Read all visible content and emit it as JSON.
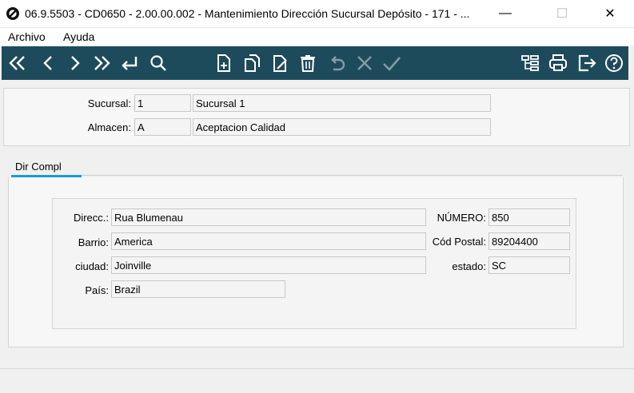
{
  "window": {
    "title": "06.9.5503 - CD0650 - 2.00.00.002 - Mantenimiento Dirección Sucursal Depósito - 171 - ...",
    "minimize": "—",
    "maximize": "☐",
    "close": "✕"
  },
  "menu": {
    "archivo": "Archivo",
    "ayuda": "Ayuda"
  },
  "toolbar": {
    "bg_color": "#1e4b5c",
    "left_icons": [
      "first-record-icon",
      "previous-record-icon",
      "next-record-icon",
      "last-record-icon",
      "goto-enter-icon",
      "search-icon"
    ],
    "mid_icons": [
      "new-record-icon",
      "copy-record-icon",
      "edit-record-icon",
      "delete-record-icon",
      "undo-icon",
      "cancel-icon",
      "confirm-icon"
    ],
    "right_icons": [
      "tree-icon",
      "print-icon",
      "exit-icon",
      "help-icon"
    ]
  },
  "header": {
    "sucursal_label": "Sucursal:",
    "sucursal_code": "1",
    "sucursal_name": "Sucursal 1",
    "almacen_label": "Almacen:",
    "almacen_code": "A",
    "almacen_name": "Aceptacion Calidad"
  },
  "tabs": {
    "dir_compl": "Dir Compl",
    "accent": "#1a9ad6"
  },
  "address": {
    "direcc_label": "Direcc.:",
    "direcc_value": "Rua Blumenau",
    "barrio_label": "Barrio:",
    "barrio_value": "America",
    "ciudad_label": "ciudad:",
    "ciudad_value": "Joinville",
    "pais_label": "País:",
    "pais_value": "Brazil",
    "numero_label": "NÚMERO:",
    "numero_value": "850",
    "cod_postal_label": "Cód Postal:",
    "cod_postal_value": "89204400",
    "estado_label": "estado:",
    "estado_value": "SC"
  }
}
